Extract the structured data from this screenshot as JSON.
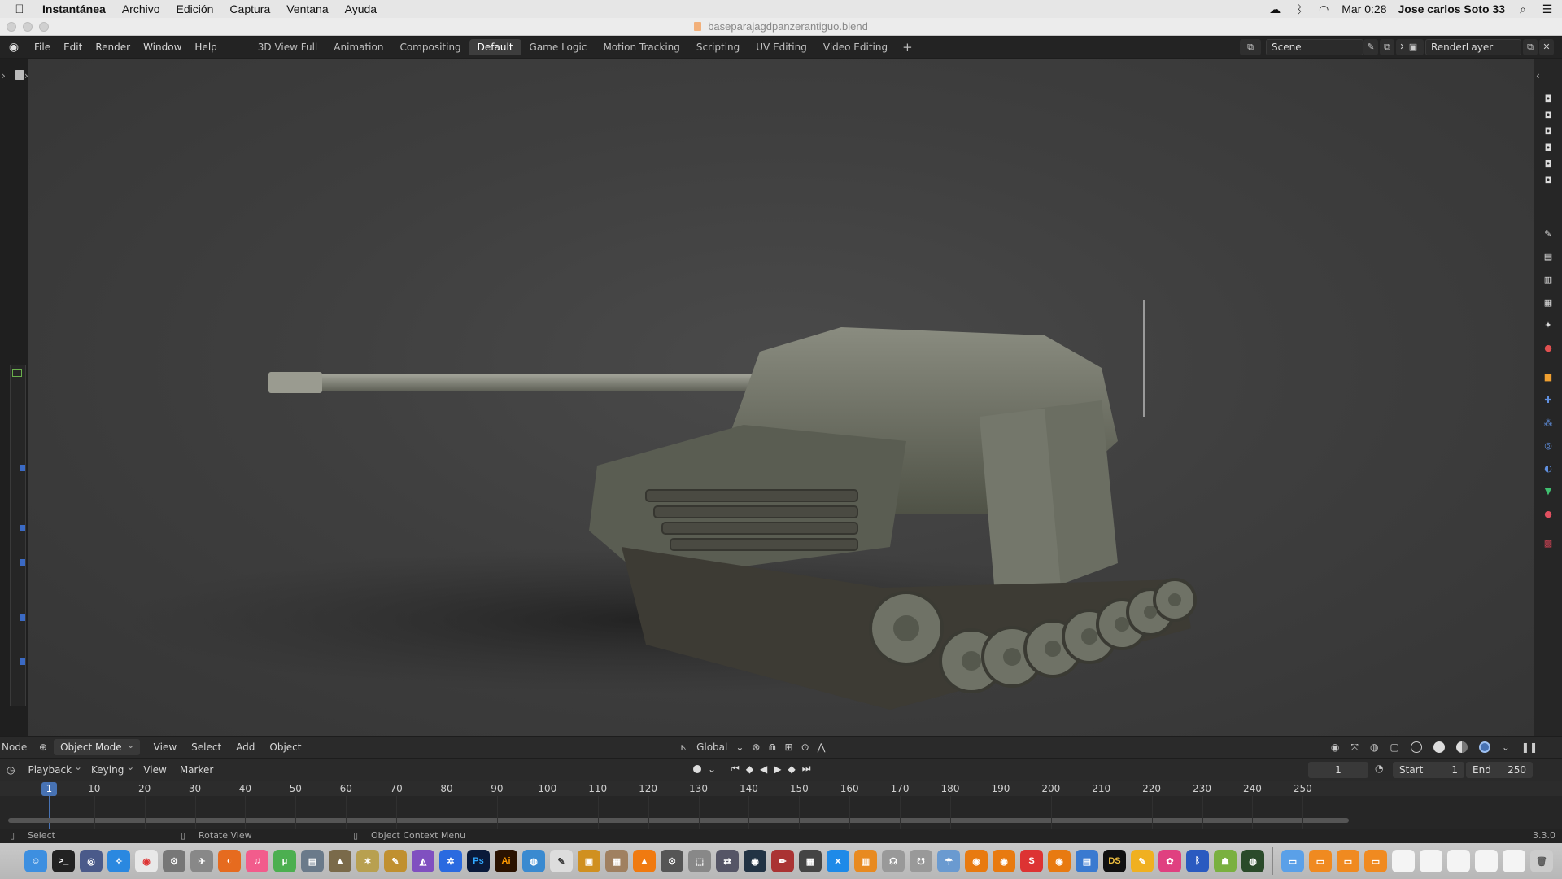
{
  "mac_menubar": {
    "app_name": "Instantánea",
    "menus": [
      "Archivo",
      "Edición",
      "Captura",
      "Ventana",
      "Ayuda"
    ],
    "clock": "Mar 0:28",
    "user": "Jose carlos Soto 33"
  },
  "window": {
    "title": "baseparajagdpanzerantiguo.blend"
  },
  "blender_topbar": {
    "menus": [
      "File",
      "Edit",
      "Render",
      "Window",
      "Help"
    ],
    "workspaces": [
      {
        "label": "3D View Full",
        "active": false
      },
      {
        "label": "Animation",
        "active": false
      },
      {
        "label": "Compositing",
        "active": false
      },
      {
        "label": "Default",
        "active": true
      },
      {
        "label": "Game Logic",
        "active": false
      },
      {
        "label": "Motion Tracking",
        "active": false
      },
      {
        "label": "Scripting",
        "active": false
      },
      {
        "label": "UV Editing",
        "active": false
      },
      {
        "label": "Video Editing",
        "active": false
      }
    ],
    "add_workspace": "+",
    "scene_name": "Scene",
    "render_layer": "RenderLayer"
  },
  "viewport_header": {
    "editor_label": "Node",
    "mode": "Object Mode",
    "menus": [
      "View",
      "Select",
      "Add",
      "Object"
    ],
    "transform_orientation": "Global"
  },
  "timeline_header": {
    "menus": [
      "Playback",
      "Keying",
      "View",
      "Marker"
    ],
    "current_frame": "1",
    "start_label": "Start",
    "start_value": "1",
    "end_label": "End",
    "end_value": "250"
  },
  "timeline": {
    "current_frame": "1",
    "ticks": [
      "10",
      "20",
      "30",
      "40",
      "50",
      "60",
      "70",
      "80",
      "90",
      "100",
      "110",
      "120",
      "130",
      "140",
      "150",
      "160",
      "170",
      "180",
      "190",
      "200",
      "210",
      "220",
      "230",
      "240",
      "250"
    ]
  },
  "statusbar": {
    "select": "Select",
    "rotate": "Rotate View",
    "context_menu": "Object Context Menu",
    "version": "3.3.0"
  },
  "dock_labels": {
    "photoshop": "Ps",
    "illustrator": "Ai",
    "ds": "DS"
  },
  "colors": {
    "accent": "#4772b3",
    "viewport_bg": "#404040",
    "panel_bg": "#232323"
  }
}
